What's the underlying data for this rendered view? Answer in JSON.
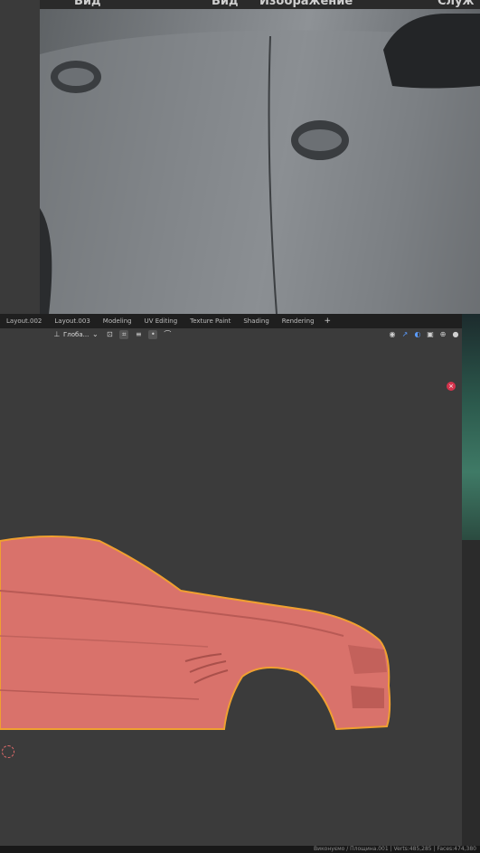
{
  "reference_photo": {
    "menu_items": [
      "Вид",
      "Вид",
      "Изображение",
      "Служ"
    ]
  },
  "workspace_tabs": [
    "Layout.002",
    "Layout.003",
    "Modeling",
    "UV Editing",
    "Texture Paint",
    "Shading",
    "Rendering"
  ],
  "add_tab": "+",
  "viewport_header": {
    "transform_orientation": "Глоба..."
  },
  "status_bar": {
    "text": "Виконуємо / Площина.001 | Verts:485,285 | Faces:474,380"
  },
  "colors": {
    "mesh": "#d9726b",
    "selection_outline": "#f0a030",
    "viewport_bg": "#3b3b3b"
  }
}
